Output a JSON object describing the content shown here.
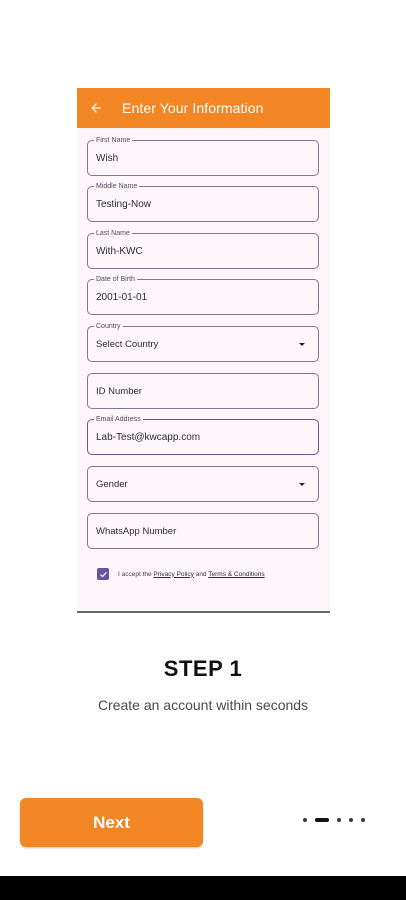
{
  "appbar": {
    "title": "Enter Your Information"
  },
  "fields": [
    {
      "label": "First Name",
      "value": "Wish"
    },
    {
      "label": "Middle Name",
      "value": "Testing-Now"
    },
    {
      "label": "Last Name",
      "value": "With-KWC"
    },
    {
      "label": "Date of Birth",
      "value": "2001-01-01"
    },
    {
      "label": "Country",
      "value": "Select Country"
    },
    {
      "label": "",
      "value": "ID Number"
    },
    {
      "label": "Email Address",
      "value": "Lab-Test@kwcapp.com"
    },
    {
      "label": "",
      "value": "Gender"
    },
    {
      "label": "",
      "value": "WhatsApp Number"
    }
  ],
  "agreement": {
    "checked": true,
    "prefix": "I accept the",
    "privacy": "Privacy Policy",
    "and": "and",
    "terms": "Terms & Conditions"
  },
  "step": {
    "title": "STEP 1",
    "subtitle": "Create an account within seconds"
  },
  "next_label": "Next",
  "pager": {
    "count": 5,
    "active": 1
  },
  "colors": {
    "accent": "#f28524",
    "purple": "#6a51a3"
  }
}
